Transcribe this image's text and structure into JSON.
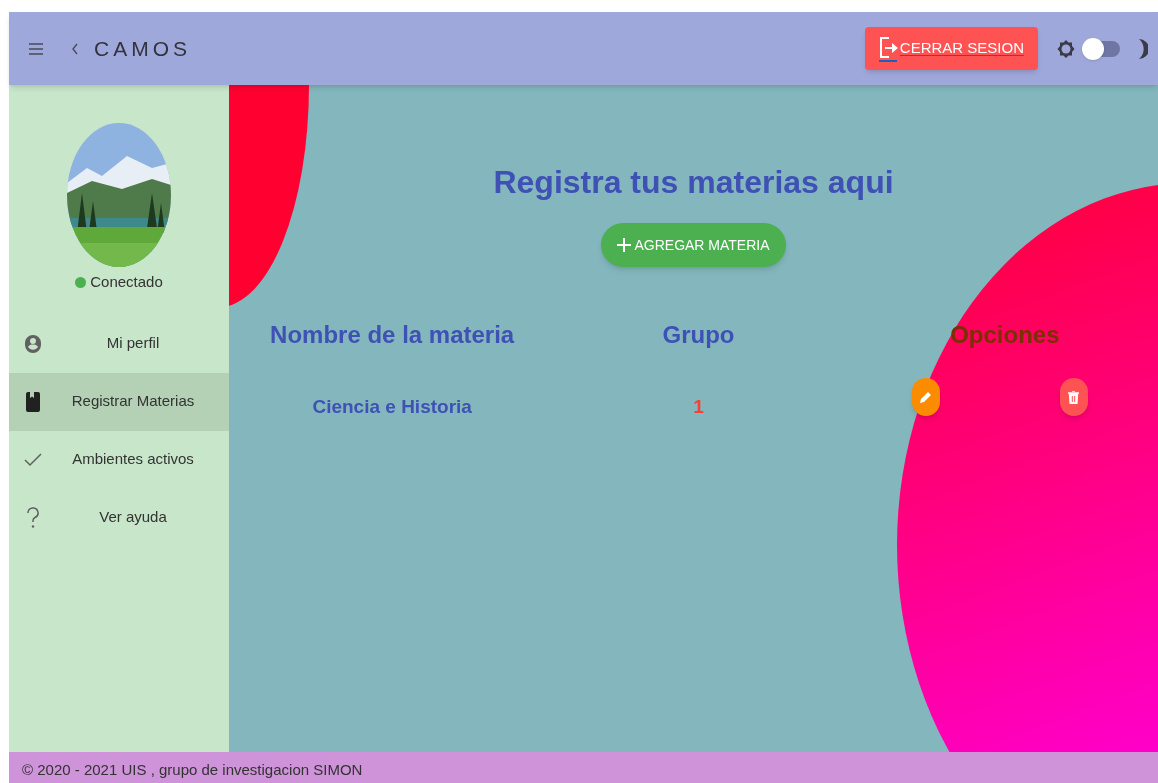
{
  "header": {
    "app_title": "CAMOS",
    "logout_button": "CERRAR SESION",
    "theme_toggle": {
      "on": false
    }
  },
  "sidebar": {
    "status": {
      "label": "Conectado",
      "color": "#4caf50"
    },
    "items": [
      {
        "kind": "profile",
        "label": "Mi perfil",
        "selected": false
      },
      {
        "kind": "book",
        "label": "Registrar Materias",
        "selected": true
      },
      {
        "kind": "check",
        "label": "Ambientes activos",
        "selected": false
      },
      {
        "kind": "help",
        "label": "Ver ayuda",
        "selected": false
      }
    ]
  },
  "main": {
    "title": "Registra tus materias aqui",
    "add_button": "AGREGAR MATERIA",
    "table": {
      "columns": [
        {
          "label": "Nombre de la materia",
          "color": "#3f51b5"
        },
        {
          "label": "Grupo",
          "color": "#3f51b5"
        },
        {
          "label": "Opciones",
          "color": "#7a3000"
        }
      ],
      "rows": [
        {
          "name": "Ciencia e Historia",
          "group": "1"
        }
      ]
    }
  },
  "footer": "© 2020 - 2021 UIS , grupo de investigacion SIMON"
}
